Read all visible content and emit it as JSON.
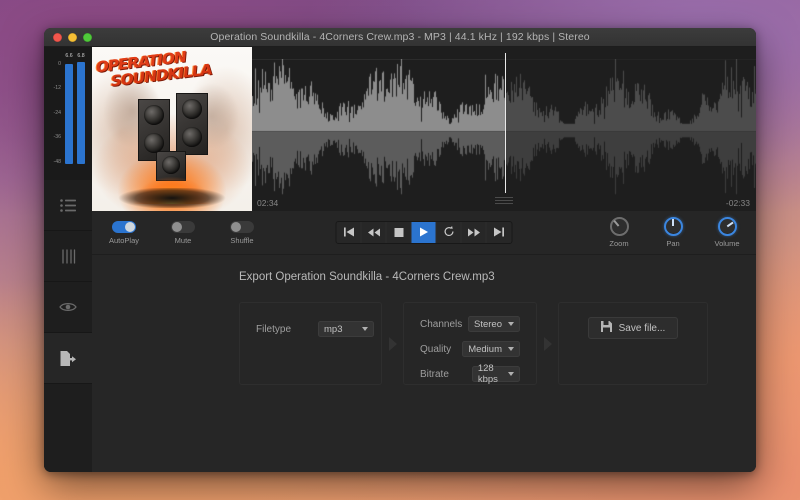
{
  "window": {
    "title": "Operation Soundkilla - 4Corners Crew.mp3 - MP3 | 44.1 kHz | 192 kbps | Stereo",
    "traffic_lights": [
      "close",
      "minimize",
      "maximize"
    ]
  },
  "meters": {
    "scale_labels": [
      "0",
      "-12",
      "-24",
      "-36",
      "-48"
    ],
    "channels": [
      {
        "name": "left",
        "value": "6.6"
      },
      {
        "name": "right",
        "value": "6.8"
      }
    ],
    "bar_color": "#2b74cf"
  },
  "rail": {
    "items": [
      {
        "name": "playlist",
        "icon": "list-icon",
        "active": false
      },
      {
        "name": "equalizer",
        "icon": "equalizer-icon",
        "active": false
      },
      {
        "name": "visualizer",
        "icon": "eye-icon",
        "active": false
      },
      {
        "name": "export",
        "icon": "export-icon",
        "active": true
      }
    ]
  },
  "artwork": {
    "title_line1": "OPERATION",
    "title_line2": "SOUNDKILLA"
  },
  "waveform": {
    "elapsed": "02:34",
    "remaining": "-02:33",
    "played_color": "#8d8d8d",
    "unplayed_color": "#4c4c4c",
    "playhead_color": "#e8e8e8"
  },
  "toggles": [
    {
      "label": "AutoPlay",
      "on": true
    },
    {
      "label": "Mute",
      "on": false
    },
    {
      "label": "Shuffle",
      "on": false
    }
  ],
  "transport": [
    {
      "name": "previous-track",
      "icon": "skip-back-icon",
      "active": false
    },
    {
      "name": "rewind",
      "icon": "rewind-icon",
      "active": false
    },
    {
      "name": "stop",
      "icon": "stop-icon",
      "active": false
    },
    {
      "name": "play",
      "icon": "play-icon",
      "active": true
    },
    {
      "name": "repeat",
      "icon": "repeat-icon",
      "active": false
    },
    {
      "name": "fast-forward",
      "icon": "fast-forward-icon",
      "active": false
    },
    {
      "name": "next-track",
      "icon": "skip-forward-icon",
      "active": false
    }
  ],
  "knobs": [
    {
      "label": "Zoom",
      "active": false,
      "angle": -40
    },
    {
      "label": "Pan",
      "active": true,
      "angle": 0
    },
    {
      "label": "Volume",
      "active": true,
      "angle": 55
    }
  ],
  "export": {
    "title": "Export Operation Soundkilla - 4Corners Crew.mp3",
    "filetype": {
      "label": "Filetype",
      "value": "mp3"
    },
    "channels": {
      "label": "Channels",
      "value": "Stereo"
    },
    "quality": {
      "label": "Quality",
      "value": "Medium"
    },
    "bitrate": {
      "label": "Bitrate",
      "value": "128 kbps"
    },
    "save_button": "Save file..."
  },
  "colors": {
    "accent": "#2b74cf",
    "window_bg": "#262626",
    "rail_bg": "#1e1e1e"
  }
}
